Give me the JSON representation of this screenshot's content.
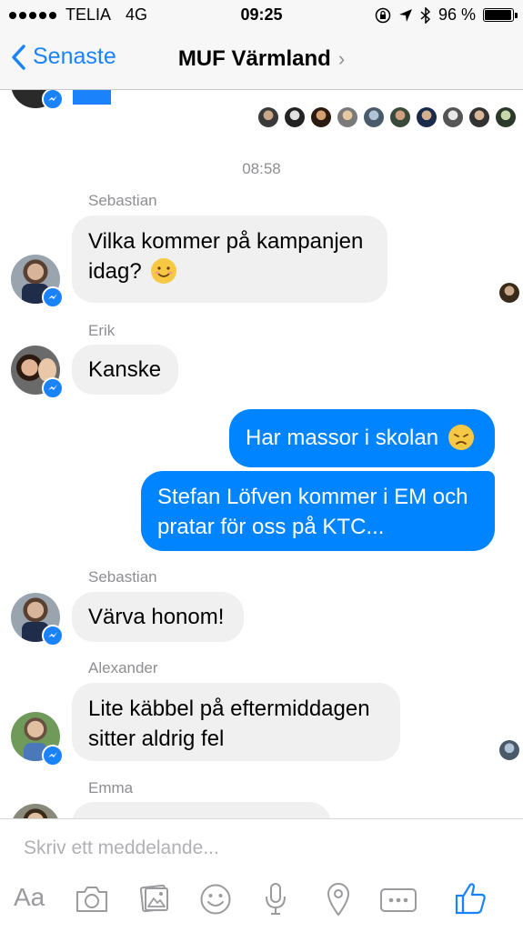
{
  "status_bar": {
    "carrier": "TELIA",
    "network": "4G",
    "time": "09:25",
    "battery": "96 %",
    "battery_level": 0.96
  },
  "nav": {
    "back_label": "Senaste",
    "title": "MUF Värmland"
  },
  "chat": {
    "timestamp": "08:58",
    "messages": [
      {
        "sender": "Sebastian",
        "text": "Vilka kommer på kampanjen idag?",
        "line1": "Vilka kommer på kampanjen",
        "line2": "idag?",
        "emoji": "smiling-emoji"
      },
      {
        "sender": "Erik",
        "text": "Kanske"
      },
      {
        "sender": "me",
        "text": "Har massor i skolan",
        "emoji": "disappointed-emoji"
      },
      {
        "sender": "me",
        "line1": "Stefan Löfven kommer i EM och",
        "line2": "pratar för oss på KTC..."
      },
      {
        "sender": "Sebastian",
        "text": "Värva honom!"
      },
      {
        "sender": "Alexander",
        "line1": "Lite käbbel på eftermiddagen",
        "line2": "sitter aldrig fel"
      },
      {
        "sender": "Emma",
        "text": ""
      }
    ]
  },
  "composer": {
    "placeholder": "Skriv ett meddelande...",
    "aa_label": "Aa",
    "icons": [
      "camera-icon",
      "gallery-icon",
      "emoji-icon",
      "microphone-icon",
      "location-icon",
      "more-icon",
      "like-icon"
    ]
  },
  "colors": {
    "accent": "#0084ff",
    "nav_accent": "#1a82fb",
    "incoming_bubble": "#f1f0f0"
  }
}
